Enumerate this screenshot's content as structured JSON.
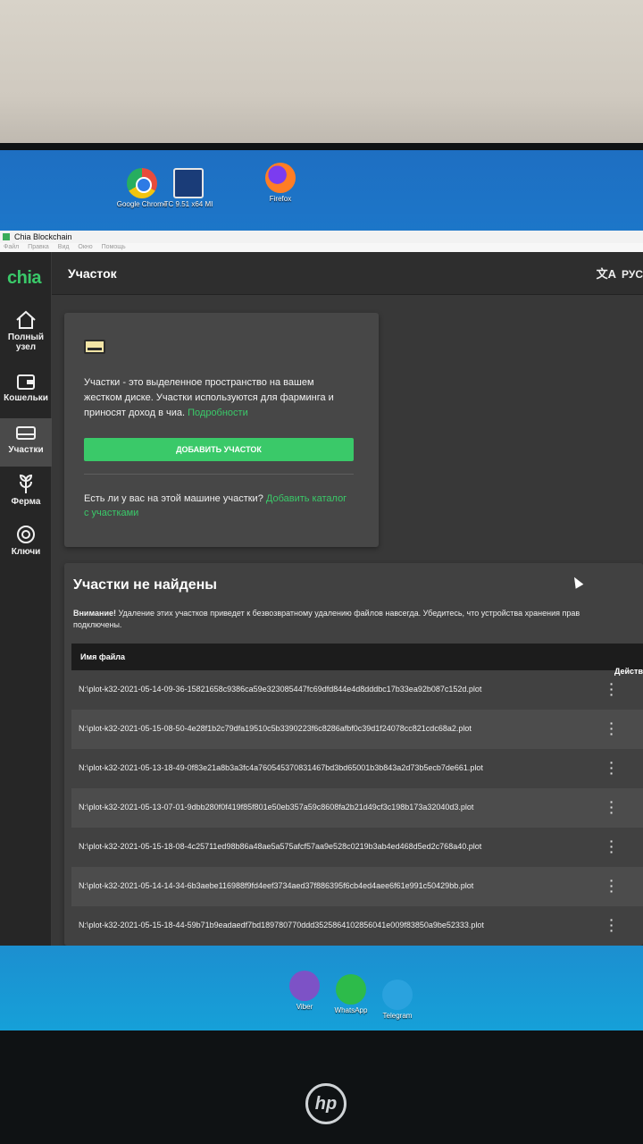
{
  "desktop": {
    "top_icons": [
      {
        "label": "Google Chrome",
        "icon": "chrome-icon"
      },
      {
        "label": "TC 9.51 x64 MI",
        "icon": "total-commander-icon"
      },
      {
        "label": "Firefox",
        "icon": "firefox-icon"
      }
    ],
    "bottom_icons": [
      {
        "label": "Viber",
        "icon": "viber-icon"
      },
      {
        "label": "WhatsApp",
        "icon": "whatsapp-icon"
      },
      {
        "label": "Telegram",
        "icon": "telegram-icon"
      }
    ]
  },
  "window": {
    "title": "Chia Blockchain",
    "menu": [
      "Файл",
      "Правка",
      "Вид",
      "Окно",
      "Помощь"
    ]
  },
  "sidebar": {
    "brand": "chia",
    "items": [
      {
        "label": "Полный узел",
        "icon": "home-icon",
        "active": false
      },
      {
        "label": "Кошельки",
        "icon": "wallet-icon",
        "active": false
      },
      {
        "label": "Участки",
        "icon": "drive-icon",
        "active": true
      },
      {
        "label": "Ферма",
        "icon": "farm-icon",
        "active": false
      },
      {
        "label": "Ключи",
        "icon": "keys-icon",
        "active": false
      }
    ]
  },
  "header": {
    "title": "Участок",
    "language": "РУС"
  },
  "plots_intro": {
    "text": "Участки - это выделенное пространство на вашем жестком диске. Участки используются для фарминга и приносят доход в чиа.",
    "learn_more": "Подробности",
    "add_button": "Добавить участок",
    "question": "Есть ли у вас на этой машине участки?",
    "add_dir_link": "Добавить каталог с участками"
  },
  "not_found": {
    "title": "Участки не найдены",
    "warning_bold": "Внимание!",
    "warning_text": "Удаление этих участков приведет к безвозвратному удалению файлов навсегда. Убедитесь, что устройства хранения прав",
    "warning_tail": "подключены."
  },
  "table": {
    "columns": {
      "file": "Имя файла",
      "actions": "Действ"
    },
    "rows": [
      "N:\\plot-k32-2021-05-14-09-36-15821658c9386ca59e323085447fc69dfd844e4d8dddbc17b33ea92b087c152d.plot",
      "N:\\plot-k32-2021-05-15-08-50-4e28f1b2c79dfa19510c5b3390223f6c8286afbf0c39d1f24078cc821cdc68a2.plot",
      "N:\\plot-k32-2021-05-13-18-49-0f83e21a8b3a3fc4a760545370831467bd3bd65001b3b843a2d73b5ecb7de661.plot",
      "N:\\plot-k32-2021-05-13-07-01-9dbb280f0f419f85f801e50eb357a59c8608fa2b21d49cf3c198b173a32040d3.plot",
      "N:\\plot-k32-2021-05-15-18-08-4c25711ed98b86a48ae5a575afcf57aa9e528c0219b3ab4ed468d5ed2c768a40.plot",
      "N:\\plot-k32-2021-05-14-14-34-6b3aebe116988f9fd4eef3734aed37f886395f6cb4ed4aee6f61e991c50429bb.plot",
      "N:\\plot-k32-2021-05-15-18-44-59b71b9eadaedf7bd189780770ddd3525864102856041e009f83850a9be52333.plot"
    ]
  },
  "monitor_brand": "hp",
  "colors": {
    "accent": "#3ac969",
    "sidebar_bg": "#262626",
    "content_bg": "#383838",
    "card_bg": "#474747"
  }
}
